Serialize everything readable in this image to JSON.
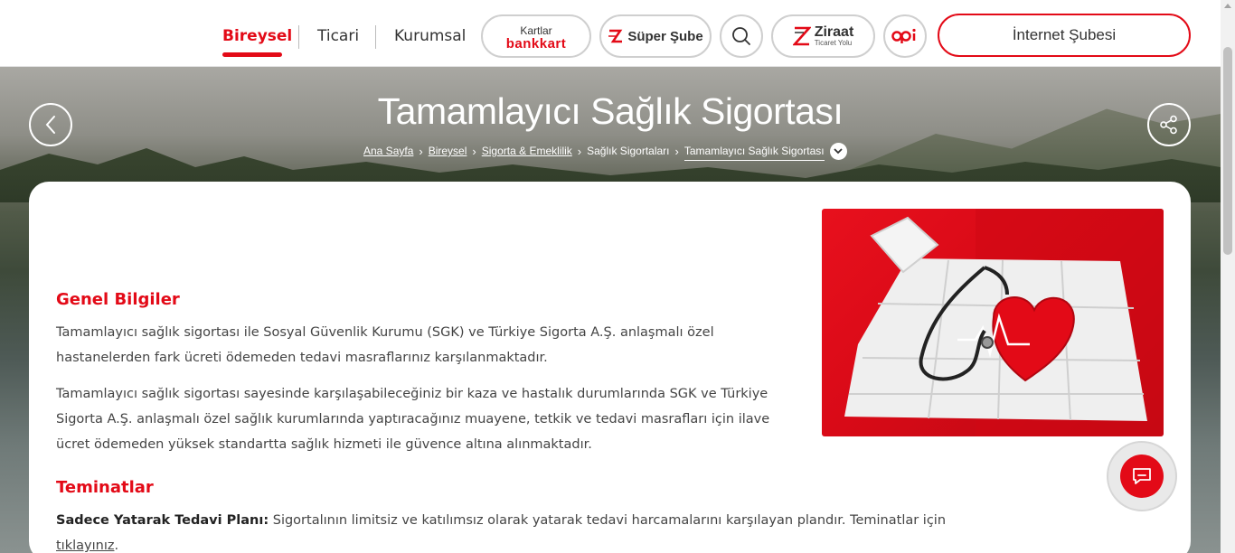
{
  "nav": {
    "items": [
      {
        "label": "Bireysel",
        "active": true
      },
      {
        "label": "Ticari",
        "active": false
      },
      {
        "label": "Kurumsal",
        "active": false
      }
    ],
    "kartlar_top": "Kartlar",
    "kartlar_bottom": "bankkart",
    "super_sube": "Süper Şube",
    "ziraat_title": "Ziraat",
    "ziraat_sub": "Ticaret Yolu",
    "internet_subesi": "İnternet Şubesi",
    "icons": {
      "search": "search-icon",
      "back": "arrow-left-icon",
      "share": "share-icon",
      "chat": "chat-icon",
      "ziraat_logo": "ziraat-logo-icon",
      "opi_logo": "opi-logo-icon"
    }
  },
  "hero": {
    "title": "Tamamlayıcı Sağlık Sigortası",
    "breadcrumb": [
      {
        "label": "Ana Sayfa",
        "link": true
      },
      {
        "label": "Bireysel",
        "link": true
      },
      {
        "label": "Sigorta & Emeklilik",
        "link": true
      },
      {
        "label": "Sağlık Sigortaları",
        "link": false
      },
      {
        "label": "Tamamlayıcı Sağlık Sigortası",
        "link": false
      }
    ]
  },
  "content": {
    "sections": [
      {
        "title": "Genel Bilgiler",
        "paragraphs": [
          "Tamamlayıcı sağlık sigortası ile Sosyal Güvenlik Kurumu (SGK) ve Türkiye Sigorta A.Ş. anlaşmalı özel hastanelerden fark ücreti ödemeden tedavi masraflarınız karşılanmaktadır.",
          "Tamamlayıcı sağlık sigortası sayesinde karşılaşabileceğiniz bir kaza ve hastalık durumlarında SGK ve Türkiye Sigorta A.Ş. anlaşmalı özel sağlık kurumlarında yaptıracağınız muayene, tetkik ve tedavi masrafları için ilave ücret ödemeden yüksek standartta sağlık hizmeti ile güvence altına alınmaktadır."
        ]
      },
      {
        "title": "Teminatlar",
        "plan_label": "Sadece Yatarak Tedavi Planı:",
        "plan_text": " Sigortalının limitsiz ve katılımsız olarak yatarak tedavi harcamalarını karşılayan plandır. Teminatlar için ",
        "plan_link": "tıklayınız",
        "plan_end": "."
      }
    ]
  },
  "colors": {
    "accent": "#e30a17",
    "text": "#444444"
  }
}
